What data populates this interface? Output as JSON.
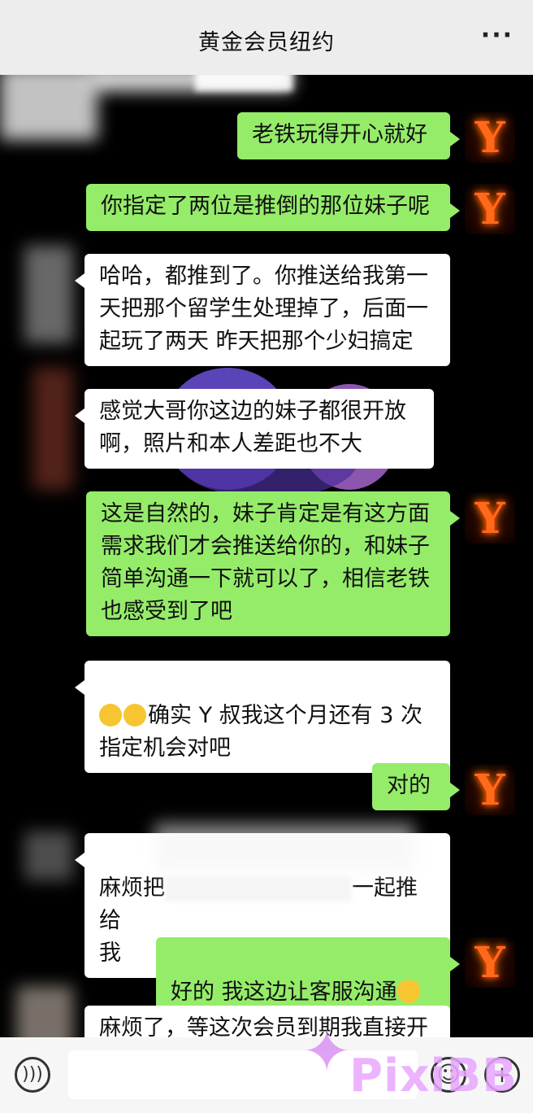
{
  "header": {
    "title": "黄金会员纽约",
    "more_icon": "more-dots-icon"
  },
  "avatar": {
    "letter": "Y"
  },
  "messages": [
    {
      "side": "mine",
      "text": "老铁玩得开心就好"
    },
    {
      "side": "mine",
      "text": "你指定了两位是推倒的那位妹子呢"
    },
    {
      "side": "theirs",
      "text": "哈哈，都推到了。你推送给我第一\n天把那个留学生处理掉了，后面一\n起玩了两天 昨天把那个少妇搞定"
    },
    {
      "side": "theirs",
      "text": "感觉大哥你这边的妹子都很开放\n啊，照片和本人差距也不大"
    },
    {
      "side": "mine",
      "text": "这是自然的，妹子肯定是有这方面\n需求我们才会推送给你的，和妹子\n简单沟通一下就可以了，相信老铁\n也感受到了吧"
    },
    {
      "side": "theirs",
      "text": "确实 Y 叔我这个月还有 3 次\n指定机会对吧"
    },
    {
      "side": "mine",
      "text": "对的"
    },
    {
      "side": "theirs",
      "text_a": "麻烦把",
      "text_b": "一起推给\n我"
    },
    {
      "side": "mine",
      "text": "好的 我这边让客服沟通"
    },
    {
      "side": "theirs",
      "text": "麻烦了，等这次会员到期我直接开"
    }
  ],
  "footer": {
    "voice_icon": "voice-icon",
    "emoji_icon": "emoji-icon",
    "plus_icon": "plus-icon"
  },
  "watermark": "PixiBB"
}
